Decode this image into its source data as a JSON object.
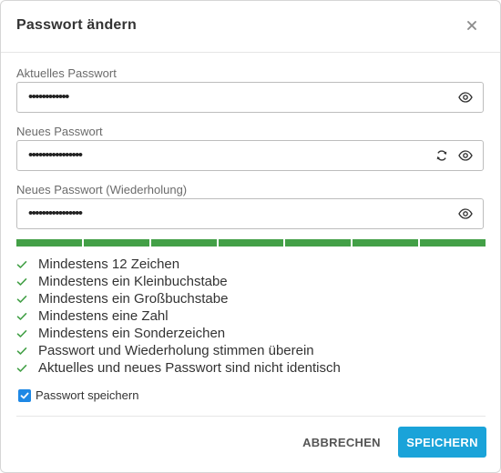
{
  "dialog": {
    "title": "Passwort ändern",
    "close_icon": "close-icon"
  },
  "fields": {
    "current": {
      "label": "Aktuelles Passwort",
      "value": "••••••••••••"
    },
    "new": {
      "label": "Neues Passwort",
      "value": "••••••••••••••••"
    },
    "repeat": {
      "label": "Neues Passwort (Wiederholung)",
      "value": "••••••••••••••••"
    }
  },
  "strength": {
    "filled_segments": 7,
    "total_segments": 7,
    "color": "#43a047"
  },
  "rules": [
    "Mindestens 12 Zeichen",
    "Mindestens ein Kleinbuchstabe",
    "Mindestens ein Großbuchstabe",
    "Mindestens eine Zahl",
    "Mindestens ein Sonderzeichen",
    "Passwort und Wiederholung stimmen überein",
    "Aktuelles und neues Passwort sind nicht identisch"
  ],
  "save_password": {
    "label": "Passwort speichern",
    "checked": true
  },
  "buttons": {
    "cancel": "ABBRECHEN",
    "save": "SPEICHERN"
  },
  "colors": {
    "accent": "#1aa3d9",
    "success": "#43a047",
    "checkbox": "#1e88e5"
  }
}
